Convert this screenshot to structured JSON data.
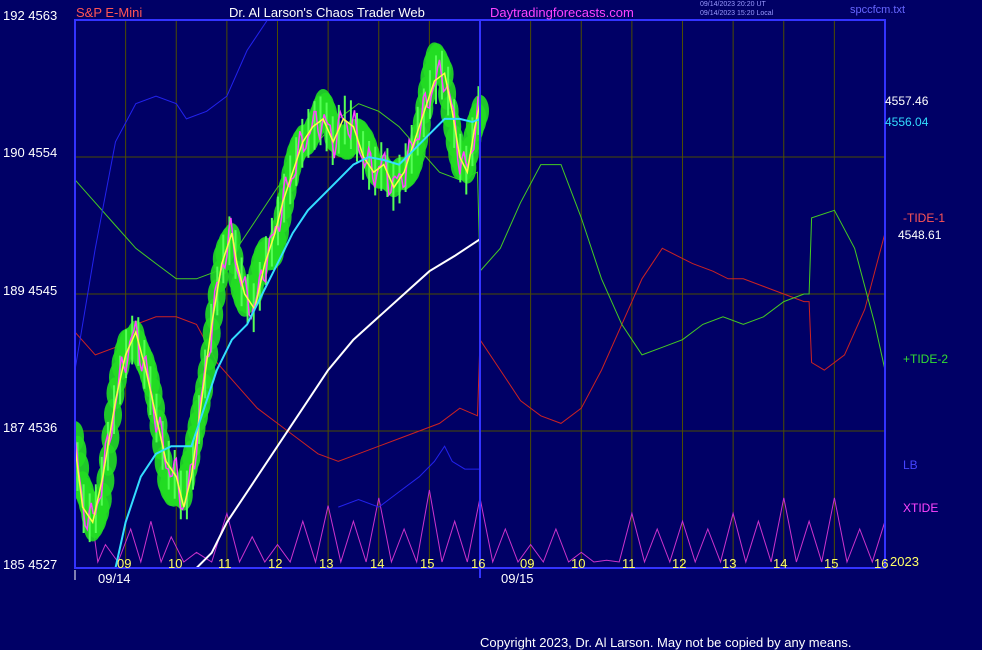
{
  "header": {
    "instrument": "S&P E-Mini",
    "site": "Dr. Al Larson's Chaos Trader Web",
    "url": "Daytradingforecasts.com",
    "timestamp_ut": "09/14/2023 20:20 UT",
    "timestamp_local": "09/14/2023 15:20 Local",
    "file": "spccfcm.txt"
  },
  "footer": {
    "copyright": "Copyright 2023, Dr. Al Larson. May not be copied by any means."
  },
  "colors": {
    "background": "#000066",
    "plot_border": "#3333ff",
    "grid": "#4d4d00",
    "price_band": "#22dd22",
    "price_fast": "#ffff44",
    "price_raw": "#ff44ff",
    "avg_cyan": "#33ddff",
    "avg_white": "#ffffff",
    "tide_minus": "#cc2222",
    "tide_plus": "#44cc22",
    "lb": "#2222ee",
    "xtide": "#cc33cc"
  },
  "chart_data": {
    "type": "line",
    "title": "S&P E-Mini",
    "y_axis": {
      "ticks": [
        {
          "label": "192 4563",
          "value": 4563
        },
        {
          "label": "190 4554",
          "value": 4554
        },
        {
          "label": "189 4545",
          "value": 4545
        },
        {
          "label": "187 4536",
          "value": 4536
        },
        {
          "label": "185 4527",
          "value": 4527
        }
      ],
      "range": [
        4527,
        4563
      ]
    },
    "x_axis": {
      "ticks": [
        "09",
        "10",
        "11",
        "12",
        "13",
        "14",
        "15",
        "16",
        "09",
        "10",
        "11",
        "12",
        "13",
        "14",
        "15",
        "16"
      ],
      "date_labels": [
        "09/14",
        "09/15"
      ],
      "year_label": "2023",
      "range": [
        0,
        16
      ],
      "day_break": 8
    },
    "readouts": [
      {
        "name": "price",
        "text": "4557.46",
        "color": "#ffffff"
      },
      {
        "name": "cyan-average",
        "text": "4556.04",
        "color": "#33ddff"
      },
      {
        "name": "white-average",
        "text": "4548.61",
        "color": "#ffffff"
      }
    ],
    "side_labels": [
      {
        "text": "-TIDE-1",
        "color": "#ff5555"
      },
      {
        "text": "+TIDE-2",
        "color": "#33dd33"
      },
      {
        "text": "LB",
        "color": "#4444ff"
      },
      {
        "text": "XTIDE",
        "color": "#ff44ff"
      }
    ],
    "series": [
      {
        "name": "price",
        "color": "#ffff44",
        "points": [
          [
            0,
            4535
          ],
          [
            0.15,
            4531
          ],
          [
            0.35,
            4530
          ],
          [
            0.55,
            4533
          ],
          [
            0.8,
            4538
          ],
          [
            1.0,
            4541
          ],
          [
            1.2,
            4542.5
          ],
          [
            1.4,
            4540
          ],
          [
            1.6,
            4537
          ],
          [
            1.8,
            4534
          ],
          [
            2.0,
            4533
          ],
          [
            2.15,
            4531
          ],
          [
            2.3,
            4533
          ],
          [
            2.5,
            4538
          ],
          [
            2.7,
            4543
          ],
          [
            2.9,
            4547
          ],
          [
            3.1,
            4549
          ],
          [
            3.2,
            4547
          ],
          [
            3.35,
            4545
          ],
          [
            3.55,
            4544
          ],
          [
            3.75,
            4547
          ],
          [
            3.95,
            4549
          ],
          [
            4.1,
            4551
          ],
          [
            4.3,
            4553
          ],
          [
            4.5,
            4555
          ],
          [
            4.7,
            4556
          ],
          [
            4.9,
            4556.5
          ],
          [
            5.1,
            4555
          ],
          [
            5.3,
            4556.5
          ],
          [
            5.5,
            4556
          ],
          [
            5.7,
            4554
          ],
          [
            5.9,
            4553
          ],
          [
            6.1,
            4553.5
          ],
          [
            6.3,
            4552
          ],
          [
            6.5,
            4553
          ],
          [
            6.7,
            4555
          ],
          [
            6.9,
            4557
          ],
          [
            7.1,
            4559
          ],
          [
            7.3,
            4559.5
          ],
          [
            7.45,
            4557
          ],
          [
            7.6,
            4554
          ],
          [
            7.75,
            4553
          ],
          [
            7.9,
            4556
          ],
          [
            8.0,
            4557.5
          ]
        ]
      },
      {
        "name": "cyan-average",
        "color": "#33ddff",
        "points": [
          [
            0.8,
            4527
          ],
          [
            1.0,
            4530
          ],
          [
            1.3,
            4533
          ],
          [
            1.6,
            4534.5
          ],
          [
            1.9,
            4535
          ],
          [
            2.1,
            4535
          ],
          [
            2.3,
            4535
          ],
          [
            2.5,
            4537
          ],
          [
            2.8,
            4540
          ],
          [
            3.1,
            4542
          ],
          [
            3.4,
            4543
          ],
          [
            3.7,
            4545
          ],
          [
            4.0,
            4547
          ],
          [
            4.3,
            4549
          ],
          [
            4.6,
            4550.5
          ],
          [
            4.9,
            4551.5
          ],
          [
            5.2,
            4552.5
          ],
          [
            5.5,
            4553.5
          ],
          [
            5.8,
            4554
          ],
          [
            6.1,
            4553.8
          ],
          [
            6.4,
            4553.5
          ],
          [
            6.7,
            4554.5
          ],
          [
            7.0,
            4555.5
          ],
          [
            7.3,
            4556.5
          ],
          [
            7.6,
            4556.5
          ],
          [
            7.85,
            4556.3
          ],
          [
            8.0,
            4556.5
          ]
        ]
      },
      {
        "name": "white-average",
        "color": "#ffffff",
        "points": [
          [
            2.4,
            4527
          ],
          [
            2.7,
            4528
          ],
          [
            3.0,
            4530
          ],
          [
            3.5,
            4532.5
          ],
          [
            4.0,
            4535
          ],
          [
            4.5,
            4537.5
          ],
          [
            5.0,
            4540
          ],
          [
            5.5,
            4542
          ],
          [
            6.0,
            4543.5
          ],
          [
            6.5,
            4545
          ],
          [
            7.0,
            4546.5
          ],
          [
            7.5,
            4547.5
          ],
          [
            8.0,
            4548.6
          ]
        ]
      },
      {
        "name": "-TIDE-1",
        "color": "#cc2222",
        "points": [
          [
            0,
            4542.5
          ],
          [
            0.4,
            4541
          ],
          [
            0.8,
            4541.5
          ],
          [
            1.2,
            4543
          ],
          [
            1.6,
            4543.5
          ],
          [
            2.0,
            4543.5
          ],
          [
            2.4,
            4543
          ],
          [
            2.8,
            4540.5
          ],
          [
            3.2,
            4539
          ],
          [
            3.6,
            4537.5
          ],
          [
            4.0,
            4536.5
          ],
          [
            4.4,
            4535.5
          ],
          [
            4.8,
            4534.5
          ],
          [
            5.2,
            4534
          ],
          [
            5.6,
            4534.5
          ],
          [
            6.0,
            4535
          ],
          [
            6.4,
            4535.5
          ],
          [
            6.8,
            4536
          ],
          [
            7.2,
            4536.5
          ],
          [
            7.6,
            4537.5
          ],
          [
            7.95,
            4537
          ],
          [
            8.0,
            4542
          ],
          [
            8.4,
            4540
          ],
          [
            8.8,
            4538
          ],
          [
            9.2,
            4537
          ],
          [
            9.6,
            4536.5
          ],
          [
            10.0,
            4537.5
          ],
          [
            10.4,
            4540
          ],
          [
            10.8,
            4543
          ],
          [
            11.2,
            4546
          ],
          [
            11.6,
            4548
          ],
          [
            11.9,
            4547.5
          ],
          [
            12.2,
            4547
          ],
          [
            12.6,
            4546.5
          ],
          [
            12.9,
            4546
          ],
          [
            13.2,
            4546
          ],
          [
            13.6,
            4545.5
          ],
          [
            14.0,
            4545
          ],
          [
            14.4,
            4544.5
          ],
          [
            14.5,
            4544.5
          ],
          [
            14.55,
            4540.5
          ],
          [
            14.8,
            4540
          ],
          [
            15.2,
            4541
          ],
          [
            15.6,
            4544
          ],
          [
            16.0,
            4549
          ]
        ]
      },
      {
        "name": "+TIDE-2",
        "color": "#44cc22",
        "points": [
          [
            0,
            4552.5
          ],
          [
            0.4,
            4551
          ],
          [
            0.8,
            4549.5
          ],
          [
            1.2,
            4548
          ],
          [
            1.6,
            4547
          ],
          [
            2.0,
            4546
          ],
          [
            2.4,
            4546
          ],
          [
            2.8,
            4546.5
          ],
          [
            3.2,
            4548
          ],
          [
            3.6,
            4550
          ],
          [
            4.0,
            4552
          ],
          [
            4.4,
            4553.5
          ],
          [
            4.8,
            4555
          ],
          [
            5.2,
            4556.5
          ],
          [
            5.6,
            4557.5
          ],
          [
            6.0,
            4557
          ],
          [
            6.4,
            4556
          ],
          [
            6.8,
            4554.5
          ],
          [
            7.2,
            4553
          ],
          [
            7.6,
            4552.5
          ],
          [
            7.95,
            4553
          ],
          [
            8.0,
            4546.5
          ],
          [
            8.4,
            4548
          ],
          [
            8.8,
            4551
          ],
          [
            9.2,
            4553.5
          ],
          [
            9.6,
            4553.5
          ],
          [
            10.0,
            4550
          ],
          [
            10.4,
            4546
          ],
          [
            10.8,
            4543
          ],
          [
            11.2,
            4541
          ],
          [
            11.6,
            4541.5
          ],
          [
            12.0,
            4542
          ],
          [
            12.4,
            4543
          ],
          [
            12.8,
            4543.5
          ],
          [
            13.2,
            4543
          ],
          [
            13.6,
            4543.5
          ],
          [
            14.0,
            4544.5
          ],
          [
            14.4,
            4545
          ],
          [
            14.5,
            4545
          ],
          [
            14.55,
            4550
          ],
          [
            15.0,
            4550.5
          ],
          [
            15.4,
            4548
          ],
          [
            15.8,
            4543
          ],
          [
            16.0,
            4540
          ]
        ]
      },
      {
        "name": "LB",
        "color": "#2222ee",
        "points": [
          [
            0,
            4540
          ],
          [
            0.4,
            4548
          ],
          [
            0.8,
            4555
          ],
          [
            1.2,
            4557.5
          ],
          [
            1.6,
            4558
          ],
          [
            2.0,
            4557.5
          ],
          [
            2.2,
            4556.5
          ],
          [
            2.6,
            4557
          ],
          [
            3.0,
            4558
          ],
          [
            3.4,
            4561
          ],
          [
            3.8,
            4563
          ],
          [
            4.2,
            4565
          ]
        ]
      },
      {
        "name": "LB-2",
        "color": "#2222ee",
        "points": [
          [
            5.2,
            4531
          ],
          [
            5.6,
            4531.5
          ],
          [
            6.0,
            4531
          ],
          [
            6.4,
            4532
          ],
          [
            6.8,
            4533
          ],
          [
            7.1,
            4534
          ],
          [
            7.3,
            4535
          ],
          [
            7.45,
            4534
          ],
          [
            7.7,
            4533.5
          ],
          [
            8.0,
            4533.5
          ]
        ]
      }
    ],
    "xtide_peaks": [
      [
        0.3,
        0.8
      ],
      [
        0.6,
        0.3
      ],
      [
        1.1,
        0.5
      ],
      [
        1.5,
        0.6
      ],
      [
        1.9,
        0.4
      ],
      [
        2.4,
        0.2
      ],
      [
        3.0,
        0.7
      ],
      [
        3.5,
        0.4
      ],
      [
        4.0,
        0.3
      ],
      [
        4.5,
        0.6
      ],
      [
        5.0,
        0.8
      ],
      [
        5.5,
        0.6
      ],
      [
        6.0,
        0.9
      ],
      [
        6.5,
        0.5
      ],
      [
        7.0,
        1.0
      ],
      [
        7.5,
        0.6
      ],
      [
        8.0,
        0.9
      ],
      [
        8.5,
        0.5
      ],
      [
        9.0,
        0.3
      ],
      [
        9.5,
        0.5
      ],
      [
        10.0,
        0.2
      ],
      [
        10.5,
        0.1
      ],
      [
        11.0,
        0.7
      ],
      [
        11.5,
        0.5
      ],
      [
        12.0,
        0.6
      ],
      [
        12.5,
        0.5
      ],
      [
        13.0,
        0.7
      ],
      [
        13.5,
        0.6
      ],
      [
        14.0,
        0.9
      ],
      [
        14.5,
        0.6
      ],
      [
        15.0,
        0.9
      ],
      [
        15.5,
        0.5
      ],
      [
        16.0,
        0.6
      ]
    ]
  }
}
